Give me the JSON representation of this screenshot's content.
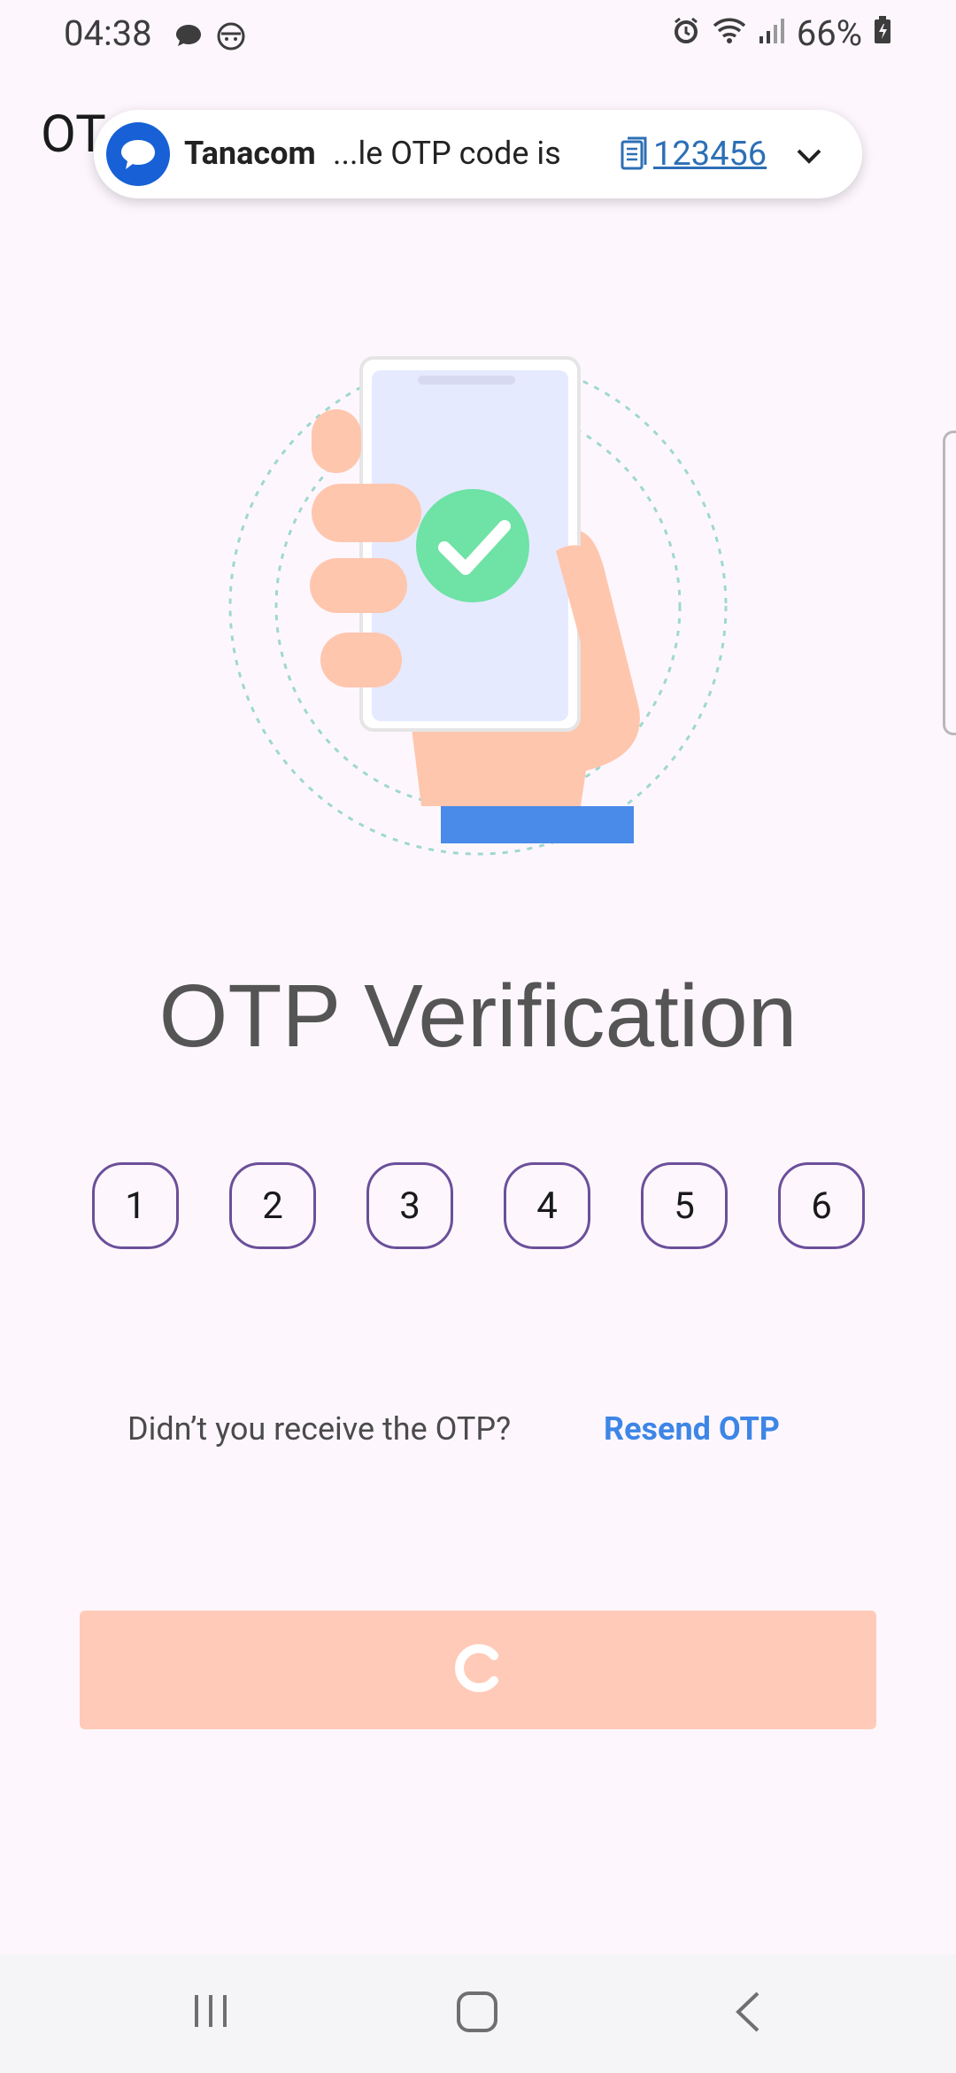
{
  "status_bar": {
    "time": "04:38",
    "battery": "66%"
  },
  "page": {
    "title_partial": "OT"
  },
  "notification": {
    "app_name": "Tanacom",
    "message": "...le OTP code is",
    "code": "123456"
  },
  "main": {
    "headline": "OTP Verification",
    "otp_digits": [
      "1",
      "2",
      "3",
      "4",
      "5",
      "6"
    ],
    "resend_question": "Didn’t you receive the OTP?",
    "resend_link": "Resend OTP"
  },
  "colors": {
    "background": "#fdf7fd",
    "accent": "#3d86e6",
    "button": "#ffcbb8",
    "otp_border": "#6b4f9a"
  },
  "icons": {
    "status_left": [
      "chat-bubble-icon",
      "face-icon"
    ],
    "status_right": [
      "alarm-icon",
      "wifi-icon",
      "signal-icon",
      "battery-icon"
    ],
    "nav": [
      "recent-apps-icon",
      "home-icon",
      "back-icon"
    ]
  }
}
